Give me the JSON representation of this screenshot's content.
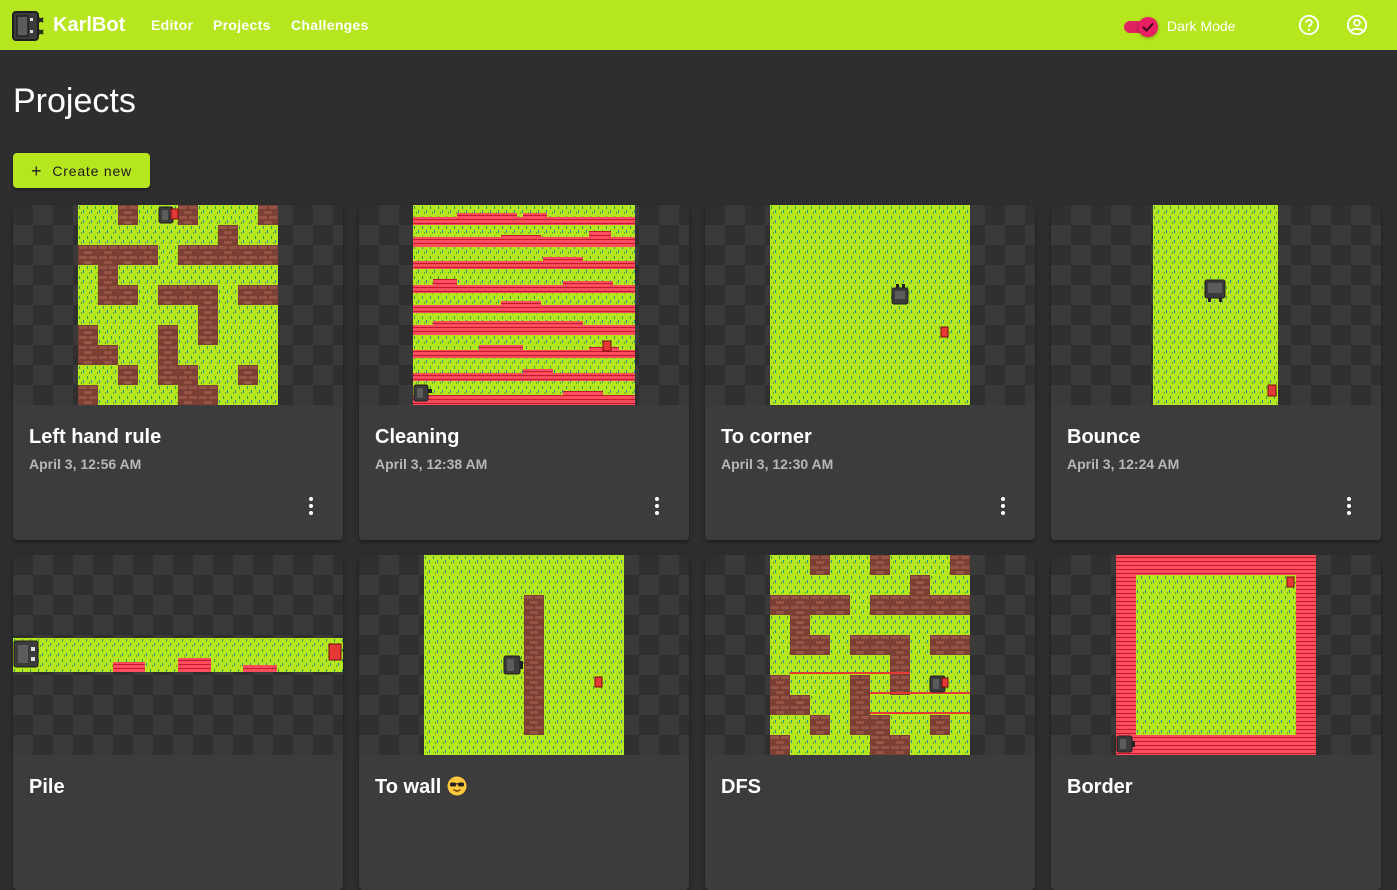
{
  "app": {
    "brand": "KarlBot"
  },
  "nav": {
    "editor": "Editor",
    "projects": "Projects",
    "challenges": "Challenges"
  },
  "header": {
    "dark_mode_label": "Dark Mode",
    "dark_mode_on": true,
    "help_icon": "help-circle-icon",
    "account_icon": "account-circle-icon"
  },
  "page": {
    "title": "Projects",
    "create_label": "Create new",
    "create_icon": "plus-icon"
  },
  "colors": {
    "accent": "#b6e61e",
    "toggle": "#e91e63",
    "background": "#2e2e2e",
    "card": "#3c3c3c",
    "grass": "#b6e61e",
    "wall": "#8b4a3c",
    "beeper": "#e53935"
  },
  "projects": [
    {
      "title": "Left hand rule",
      "date": "April 3, 12:56 AM"
    },
    {
      "title": "Cleaning",
      "date": "April 3, 12:38 AM"
    },
    {
      "title": "To corner",
      "date": "April 3, 12:30 AM"
    },
    {
      "title": "Bounce",
      "date": "April 3, 12:24 AM"
    },
    {
      "title": "Pile",
      "date": ""
    },
    {
      "title": "To wall",
      "date": "",
      "emoji": "sunglasses-emoji"
    },
    {
      "title": "DFS",
      "date": ""
    },
    {
      "title": "Border",
      "date": ""
    }
  ]
}
